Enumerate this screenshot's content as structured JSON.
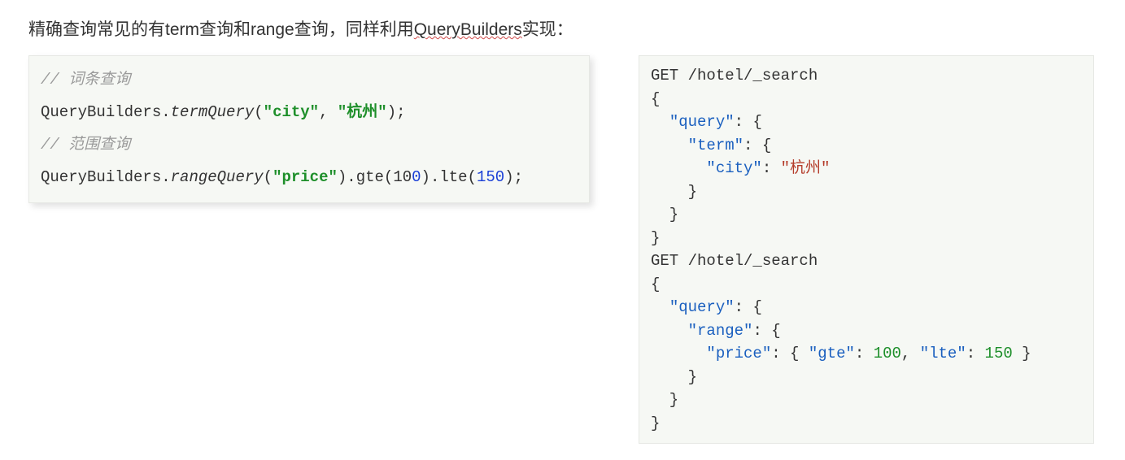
{
  "heading": {
    "pre": "精确查询常见的有term查询和range查询，同样利用",
    "underlined": "QueryBuilders",
    "post": "实现："
  },
  "left_code": {
    "tokens": [
      {
        "t": "// 词条查询",
        "c": "tk-comment"
      },
      {
        "t": "\n",
        "c": ""
      },
      {
        "t": "QueryBuilders.",
        "c": "tk-plain"
      },
      {
        "t": "termQuery",
        "c": "tk-method-italic"
      },
      {
        "t": "(",
        "c": "tk-plain"
      },
      {
        "t": "\"city\"",
        "c": "tk-str-green"
      },
      {
        "t": ", ",
        "c": "tk-plain"
      },
      {
        "t": "\"杭州\"",
        "c": "tk-str-green"
      },
      {
        "t": ");",
        "c": "tk-plain"
      },
      {
        "t": "\n",
        "c": ""
      },
      {
        "t": "// 范围查询",
        "c": "tk-comment"
      },
      {
        "t": "\n",
        "c": ""
      },
      {
        "t": "QueryBuilders.",
        "c": "tk-plain"
      },
      {
        "t": "rangeQuery",
        "c": "tk-method-italic"
      },
      {
        "t": "(",
        "c": "tk-plain"
      },
      {
        "t": "\"price\"",
        "c": "tk-str-green"
      },
      {
        "t": ").gte(",
        "c": "tk-plain"
      },
      {
        "t": "10",
        "c": "tk-plain"
      },
      {
        "t": "0",
        "c": "tk-num-blue"
      },
      {
        "t": ").lte(",
        "c": "tk-plain"
      },
      {
        "t": "150",
        "c": "tk-num-blue"
      },
      {
        "t": ");",
        "c": "tk-plain"
      }
    ]
  },
  "right_code": {
    "tokens": [
      {
        "t": "GET /hotel/_search",
        "c": "tk-plain"
      },
      {
        "t": "\n",
        "c": ""
      },
      {
        "t": "{",
        "c": "tk-plain"
      },
      {
        "t": "\n",
        "c": ""
      },
      {
        "t": "  ",
        "c": ""
      },
      {
        "t": "\"query\"",
        "c": "tk-key"
      },
      {
        "t": ": {",
        "c": "tk-plain"
      },
      {
        "t": "\n",
        "c": ""
      },
      {
        "t": "    ",
        "c": ""
      },
      {
        "t": "\"term\"",
        "c": "tk-key"
      },
      {
        "t": ": {",
        "c": "tk-plain"
      },
      {
        "t": "\n",
        "c": ""
      },
      {
        "t": "      ",
        "c": ""
      },
      {
        "t": "\"city\"",
        "c": "tk-key"
      },
      {
        "t": ": ",
        "c": "tk-plain"
      },
      {
        "t": "\"杭州\"",
        "c": "tk-str-red"
      },
      {
        "t": "\n",
        "c": ""
      },
      {
        "t": "    }",
        "c": "tk-plain"
      },
      {
        "t": "\n",
        "c": ""
      },
      {
        "t": "  }",
        "c": "tk-plain"
      },
      {
        "t": "\n",
        "c": ""
      },
      {
        "t": "}",
        "c": "tk-plain"
      },
      {
        "t": "\n",
        "c": ""
      },
      {
        "t": "GET /hotel/_search",
        "c": "tk-plain"
      },
      {
        "t": "\n",
        "c": ""
      },
      {
        "t": "{",
        "c": "tk-plain"
      },
      {
        "t": "\n",
        "c": ""
      },
      {
        "t": "  ",
        "c": ""
      },
      {
        "t": "\"query\"",
        "c": "tk-key"
      },
      {
        "t": ": {",
        "c": "tk-plain"
      },
      {
        "t": "\n",
        "c": ""
      },
      {
        "t": "    ",
        "c": ""
      },
      {
        "t": "\"range\"",
        "c": "tk-key"
      },
      {
        "t": ": {",
        "c": "tk-plain"
      },
      {
        "t": "\n",
        "c": ""
      },
      {
        "t": "      ",
        "c": ""
      },
      {
        "t": "\"price\"",
        "c": "tk-key"
      },
      {
        "t": ": { ",
        "c": "tk-plain"
      },
      {
        "t": "\"gte\"",
        "c": "tk-key"
      },
      {
        "t": ": ",
        "c": "tk-plain"
      },
      {
        "t": "100",
        "c": "tk-num-green"
      },
      {
        "t": ", ",
        "c": "tk-plain"
      },
      {
        "t": "\"lte\"",
        "c": "tk-key"
      },
      {
        "t": ": ",
        "c": "tk-plain"
      },
      {
        "t": "150",
        "c": "tk-num-green"
      },
      {
        "t": " }",
        "c": "tk-plain"
      },
      {
        "t": "\n",
        "c": ""
      },
      {
        "t": "    }",
        "c": "tk-plain"
      },
      {
        "t": "\n",
        "c": ""
      },
      {
        "t": "  }",
        "c": "tk-plain"
      },
      {
        "t": "\n",
        "c": ""
      },
      {
        "t": "}",
        "c": "tk-plain"
      }
    ]
  }
}
